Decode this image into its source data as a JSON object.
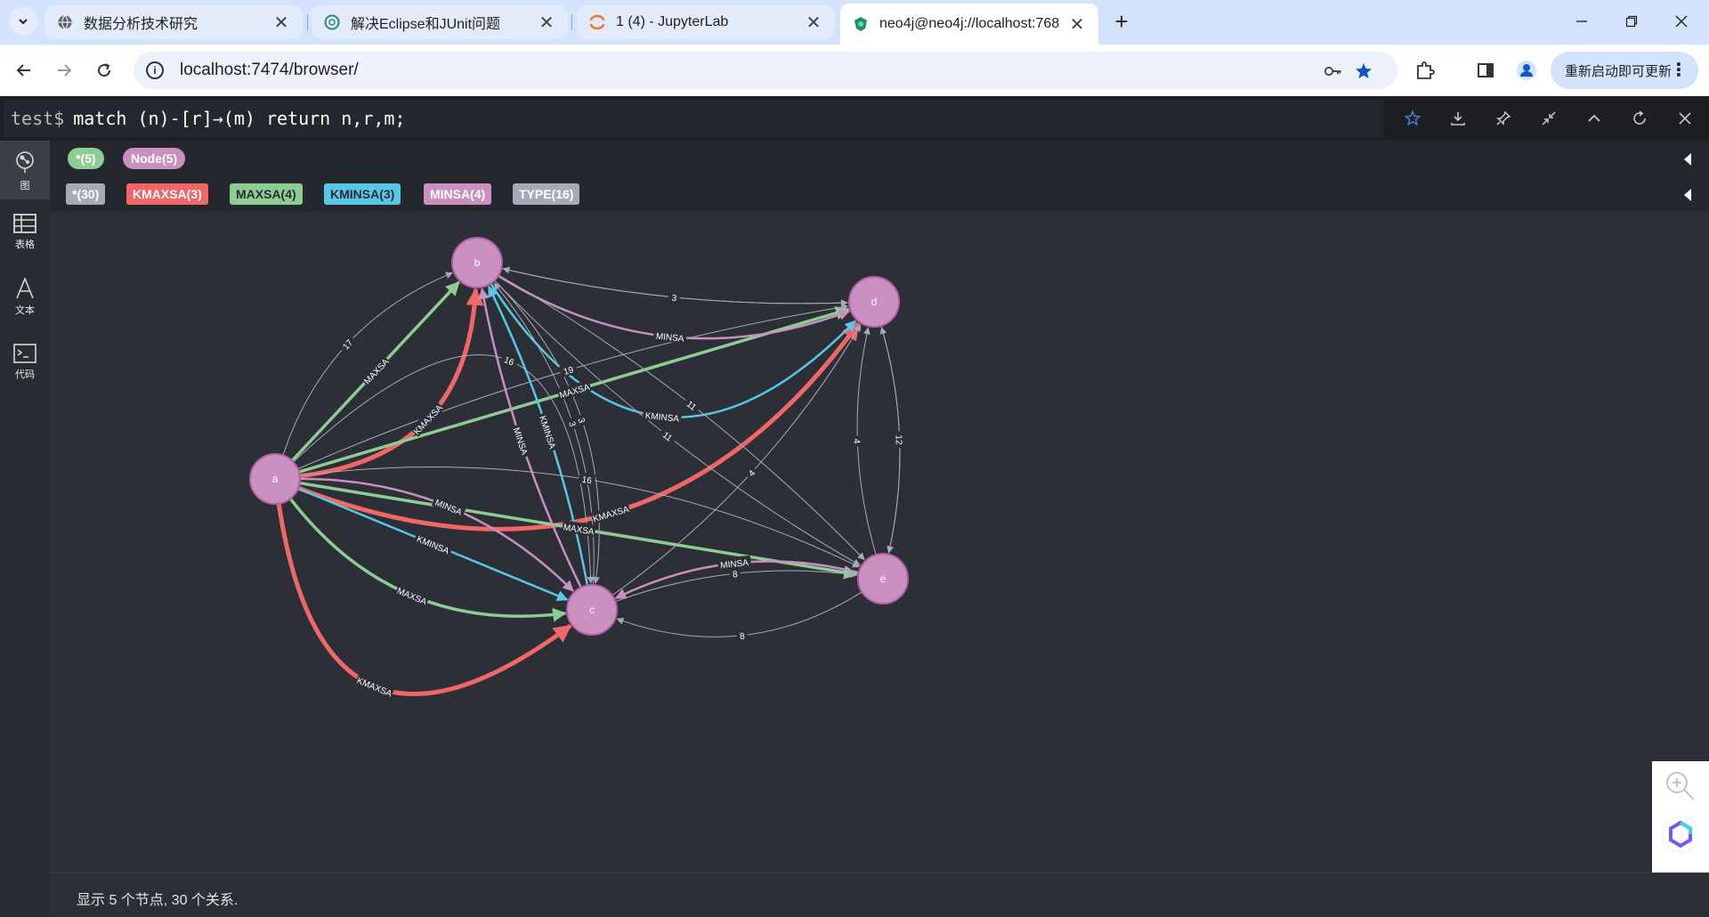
{
  "browser": {
    "tabs": [
      {
        "title": "数据分析技术研究",
        "close": "✕"
      },
      {
        "title": "解决Eclipse和JUnit问题",
        "close": "✕"
      },
      {
        "title": "1 (4) - JupyterLab",
        "close": "✕"
      },
      {
        "title": "neo4j@neo4j://localhost:768",
        "close": "✕"
      }
    ],
    "new_tab": "+",
    "url": "localhost:7474/browser/",
    "update_button": "重新启动即可更新"
  },
  "query": {
    "prompt": "test$",
    "text": "match (n)-[r]→(m) return n,r,m;"
  },
  "sidebar": {
    "items": [
      {
        "label": "图",
        "icon": "graph-icon"
      },
      {
        "label": "表格",
        "icon": "table-icon"
      },
      {
        "label": "文本",
        "icon": "text-icon"
      },
      {
        "label": "代码",
        "icon": "code-icon"
      }
    ]
  },
  "legend": {
    "node_labels": [
      {
        "text": "*(5)",
        "color": "#8dcc93"
      },
      {
        "text": "Node(5)",
        "color": "#c990c0"
      }
    ],
    "rel_types": [
      {
        "text": "*(30)",
        "color": "#a5abb6",
        "fg": "#ffffff"
      },
      {
        "text": "KMAXSA(3)",
        "color": "#f16667",
        "fg": "#ffffff"
      },
      {
        "text": "MAXSA(4)",
        "color": "#8dcc93",
        "fg": "#2a2c33"
      },
      {
        "text": "KMINSA(3)",
        "color": "#57c7e3",
        "fg": "#2a2c33"
      },
      {
        "text": "MINSA(4)",
        "color": "#c990c0",
        "fg": "#ffffff"
      },
      {
        "text": "TYPE(16)",
        "color": "#a5abb6",
        "fg": "#ffffff"
      }
    ]
  },
  "graph": {
    "nodes": [
      {
        "id": "a",
        "label": "a"
      },
      {
        "id": "b",
        "label": "b"
      },
      {
        "id": "c",
        "label": "c"
      },
      {
        "id": "d",
        "label": "d"
      },
      {
        "id": "e",
        "label": "e"
      }
    ],
    "edges": [
      {
        "from": "a",
        "to": "b",
        "type": "KMAXSA",
        "label": "KMAXSA"
      },
      {
        "from": "a",
        "to": "b",
        "type": "MAXSA",
        "label": "MAXSA"
      },
      {
        "from": "a",
        "to": "b",
        "type": "TYPE",
        "label": "17"
      },
      {
        "from": "a",
        "to": "d",
        "type": "KMAXSA",
        "label": "KMAXSA"
      },
      {
        "from": "a",
        "to": "d",
        "type": "MAXSA",
        "label": "MAXSA"
      },
      {
        "from": "a",
        "to": "c",
        "type": "KMAXSA",
        "label": "KMAXSA"
      },
      {
        "from": "a",
        "to": "c",
        "type": "MAXSA",
        "label": "MAXSA"
      },
      {
        "from": "a",
        "to": "c",
        "type": "KMINSA",
        "label": "KMINSA"
      },
      {
        "from": "a",
        "to": "c",
        "type": "MINSA",
        "label": "MINSA"
      },
      {
        "from": "a",
        "to": "c",
        "type": "TYPE",
        "label": "16"
      },
      {
        "from": "a",
        "to": "e",
        "type": "MAXSA",
        "label": "MAXSA"
      },
      {
        "from": "a",
        "to": "e",
        "type": "TYPE",
        "label": "16"
      },
      {
        "from": "a",
        "to": "d",
        "type": "TYPE",
        "label": "19"
      },
      {
        "from": "b",
        "to": "d",
        "type": "KMINSA",
        "label": "KMINSA"
      },
      {
        "from": "b",
        "to": "d",
        "type": "MINSA",
        "label": "MINSA"
      },
      {
        "from": "b",
        "to": "d",
        "type": "TYPE",
        "label": "3"
      },
      {
        "from": "d",
        "to": "b",
        "type": "TYPE",
        "label": "3"
      },
      {
        "from": "b",
        "to": "e",
        "type": "TYPE",
        "label": "11"
      },
      {
        "from": "b",
        "to": "e",
        "type": "TYPE",
        "label": "11"
      },
      {
        "from": "b",
        "to": "c",
        "type": "TYPE",
        "label": "3"
      },
      {
        "from": "c",
        "to": "b",
        "type": "TYPE",
        "label": "3"
      },
      {
        "from": "c",
        "to": "b",
        "type": "MINSA",
        "label": "MINSA"
      },
      {
        "from": "c",
        "to": "b",
        "type": "KMINSA",
        "label": "KMINSA"
      },
      {
        "from": "c",
        "to": "d",
        "type": "TYPE",
        "label": "4"
      },
      {
        "from": "e",
        "to": "d",
        "type": "TYPE",
        "label": "4"
      },
      {
        "from": "d",
        "to": "e",
        "type": "TYPE",
        "label": "12"
      },
      {
        "from": "e",
        "to": "d",
        "type": "TYPE",
        "label": "12"
      },
      {
        "from": "e",
        "to": "c",
        "type": "MINSA",
        "label": "MINSA"
      },
      {
        "from": "c",
        "to": "e",
        "type": "TYPE",
        "label": "8"
      },
      {
        "from": "e",
        "to": "c",
        "type": "TYPE",
        "label": "8"
      }
    ]
  },
  "status": "显示 5 个节点, 30 个关系."
}
